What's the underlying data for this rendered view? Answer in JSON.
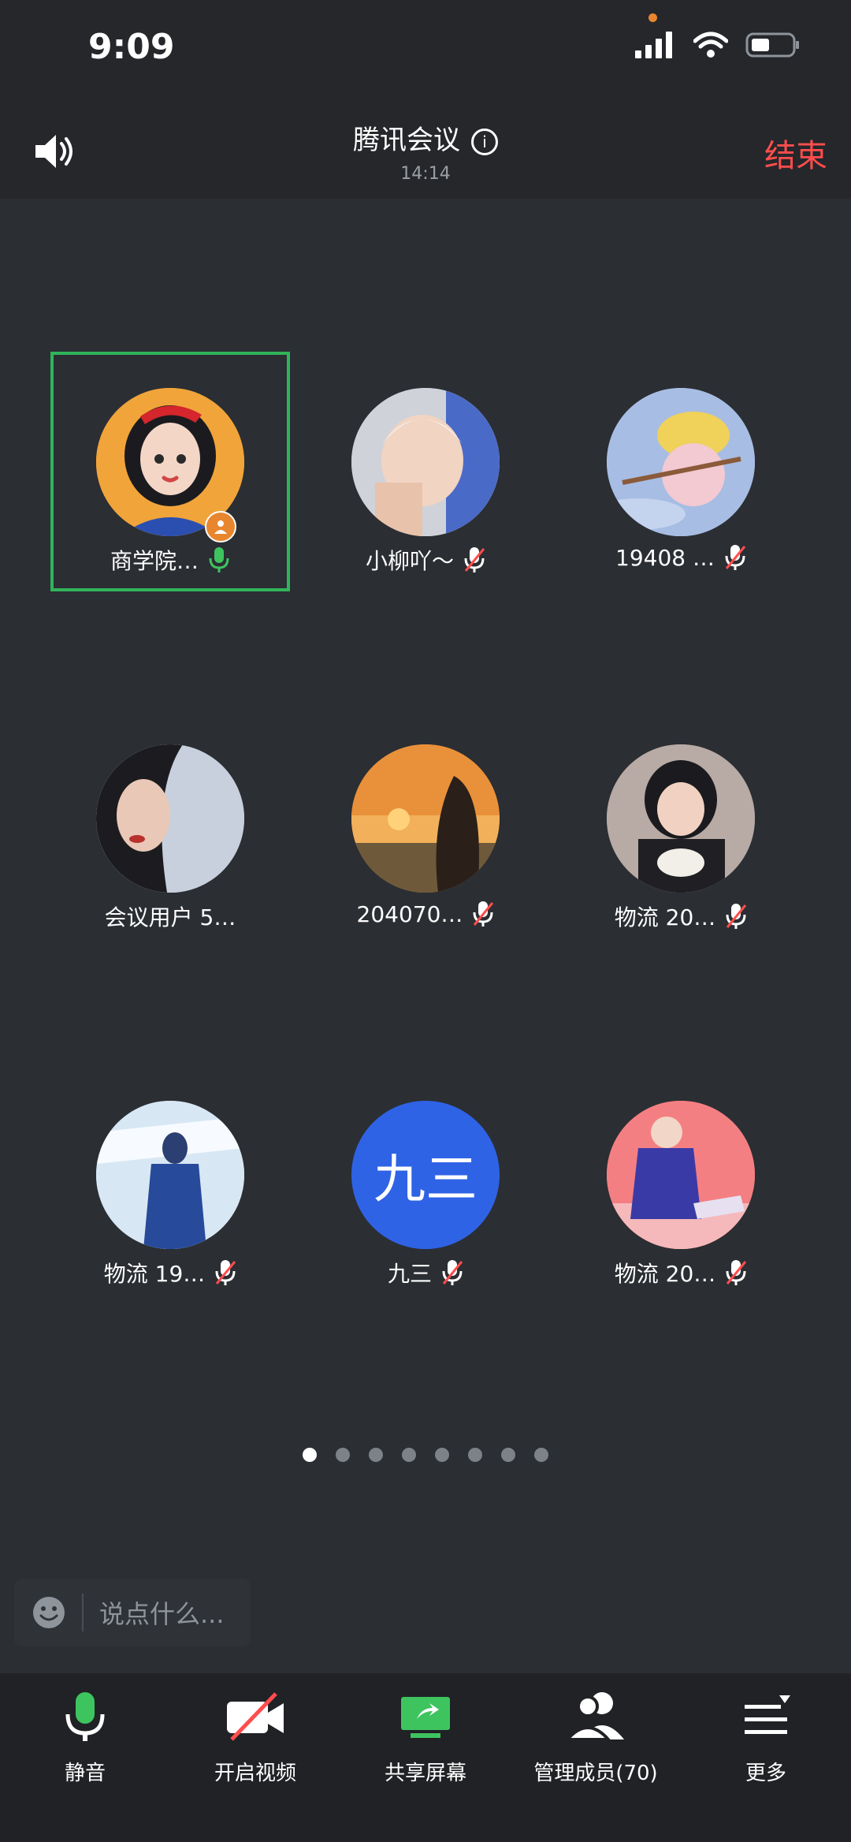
{
  "status_bar": {
    "time": "9:09"
  },
  "header": {
    "title": "腾讯会议",
    "meeting_time": "14:14",
    "end_label": "结束"
  },
  "participants": [
    {
      "name": "商学院…",
      "mic": "on",
      "host": true
    },
    {
      "name": "小柳吖～",
      "mic": "off"
    },
    {
      "name": "19408 …",
      "mic": "off"
    },
    {
      "name": "会议用户 5…",
      "mic": "none"
    },
    {
      "name": "204070…",
      "mic": "off"
    },
    {
      "name": "物流 20…",
      "mic": "off"
    },
    {
      "name": "物流 19…",
      "mic": "off"
    },
    {
      "name": "九三",
      "avatar_text": "九三",
      "mic": "off"
    },
    {
      "name": "物流 20…",
      "mic": "off"
    }
  ],
  "pagination": {
    "count": 8,
    "active_index": 0
  },
  "chat": {
    "placeholder": "说点什么..."
  },
  "toolbar": {
    "mute_label": "静音",
    "video_label": "开启视频",
    "share_label": "共享屏幕",
    "members_label": "管理成员(70)",
    "more_label": "更多"
  },
  "colors": {
    "accent_green": "#31b45b",
    "end_red": "#ff4d4d",
    "avatar_blue": "#2f63e6"
  }
}
